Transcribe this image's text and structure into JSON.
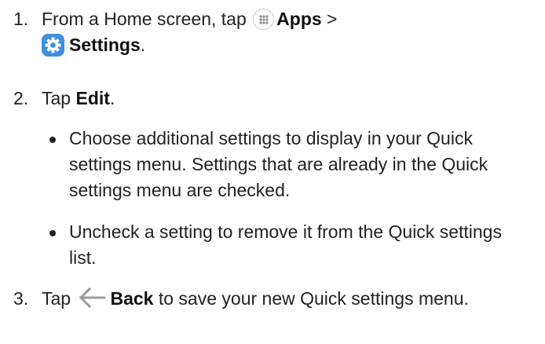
{
  "steps": [
    {
      "number": "1.",
      "text_before_icon": "From a Home screen, tap ",
      "apps_label": "Apps",
      "separator": " >",
      "settings_label": "Settings",
      "period": "."
    },
    {
      "number": "2.",
      "text_before": "Tap ",
      "edit_label": "Edit",
      "period": "."
    },
    {
      "number": "3.",
      "text_before": "Tap ",
      "back_label": "Back",
      "text_after": " to save your new Quick settings menu."
    }
  ],
  "bullets": [
    "Choose additional settings to display in your Quick settings menu. Settings that are already in the Quick settings menu are checked.",
    "Uncheck a setting to remove it from the Quick settings list."
  ],
  "icons": {
    "apps": "apps-grid-icon",
    "settings": "settings-gear-icon",
    "back": "back-arrow-icon"
  },
  "colors": {
    "text": "#222222",
    "settings_icon_bg": "#3d8fe0",
    "apps_icon_dots": "#8a8a8a",
    "back_arrow": "#9a9a9a"
  }
}
